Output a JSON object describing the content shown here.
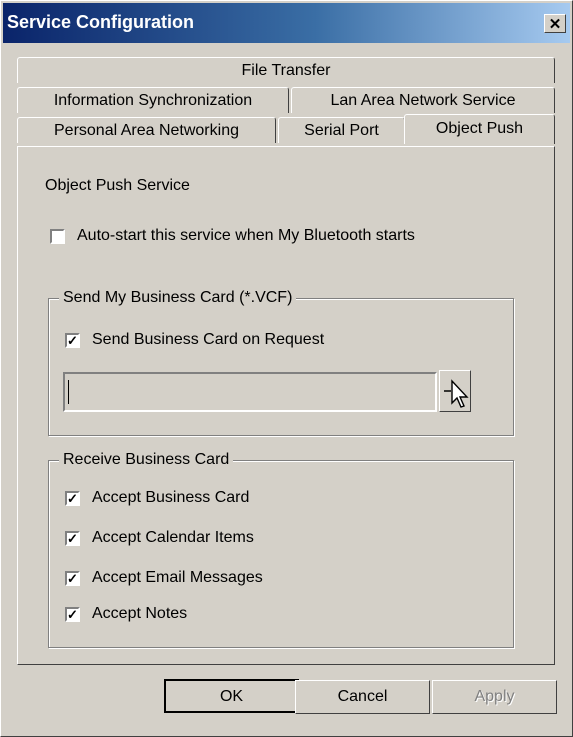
{
  "window": {
    "title": "Service Configuration",
    "close_glyph": "✕"
  },
  "tabs": {
    "row1": [
      "File Transfer"
    ],
    "row2": [
      "Information Synchronization",
      "Lan Area Network Service"
    ],
    "row3": [
      "Personal Area Networking",
      "Serial Port",
      "Object Push"
    ],
    "active": "Object Push"
  },
  "panel": {
    "heading": "Object Push Service",
    "autostart": {
      "label": "Auto-start this service when My Bluetooth starts",
      "checked": false
    },
    "send_group": {
      "legend": "Send My Business Card (*.VCF)",
      "send_on_request": {
        "label": "Send Business Card on Request",
        "checked": true
      },
      "path_value": "",
      "browse_icon": "cursor-arrow-icon"
    },
    "receive_group": {
      "legend": "Receive Business Card",
      "items": [
        {
          "label": "Accept Business Card",
          "checked": true
        },
        {
          "label": "Accept Calendar Items",
          "checked": true
        },
        {
          "label": "Accept Email Messages",
          "checked": true
        },
        {
          "label": "Accept Notes",
          "checked": true
        }
      ]
    }
  },
  "buttons": {
    "ok": "OK",
    "cancel": "Cancel",
    "apply": "Apply"
  },
  "colors": {
    "titlebar_start": "#0a246a",
    "titlebar_end": "#a6caf0",
    "face": "#d4d0c8"
  }
}
